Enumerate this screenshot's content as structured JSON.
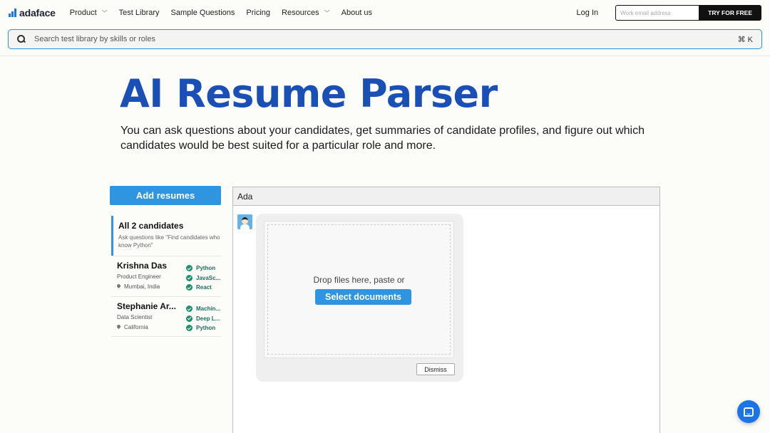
{
  "nav": {
    "logo": "adaface",
    "items": [
      {
        "label": "Product",
        "dropdown": true
      },
      {
        "label": "Test Library",
        "dropdown": false
      },
      {
        "label": "Sample Questions",
        "dropdown": false
      },
      {
        "label": "Pricing",
        "dropdown": false
      },
      {
        "label": "Resources",
        "dropdown": true
      },
      {
        "label": "About us",
        "dropdown": false
      }
    ],
    "login": "Log In",
    "email_placeholder": "Work email address",
    "try_button": "TRY FOR FREE"
  },
  "search": {
    "placeholder": "Search test library by skills or roles",
    "shortcut": "⌘ K"
  },
  "hero": {
    "title": "AI Resume Parser",
    "subtitle": "You can ask questions about your candidates, get summaries of candidate profiles, and figure out which candidates would be best suited for a particular role and more."
  },
  "sidebar": {
    "add_button": "Add resumes",
    "all": {
      "title": "All 2 candidates",
      "hint": "Ask questions like \"Find candidates who know Python\""
    },
    "candidates": [
      {
        "name": "Krishna Das",
        "role": "Product Engineer",
        "location": "Mumbai, India",
        "skills": [
          "Python",
          "JavaSc...",
          "React"
        ]
      },
      {
        "name": "Stephanie Ar...",
        "role": "Data Scientist",
        "location": "California",
        "skills": [
          "Machin...",
          "Deep L...",
          "Python"
        ]
      }
    ]
  },
  "chat": {
    "header": "Ada",
    "drop_text": "Drop files here, paste or",
    "select_button": "Select documents",
    "dismiss_button": "Dismiss"
  },
  "colors": {
    "brand_blue": "#1a4fb6",
    "accent": "#2f95e1",
    "skill_green": "#1e8f6b"
  }
}
